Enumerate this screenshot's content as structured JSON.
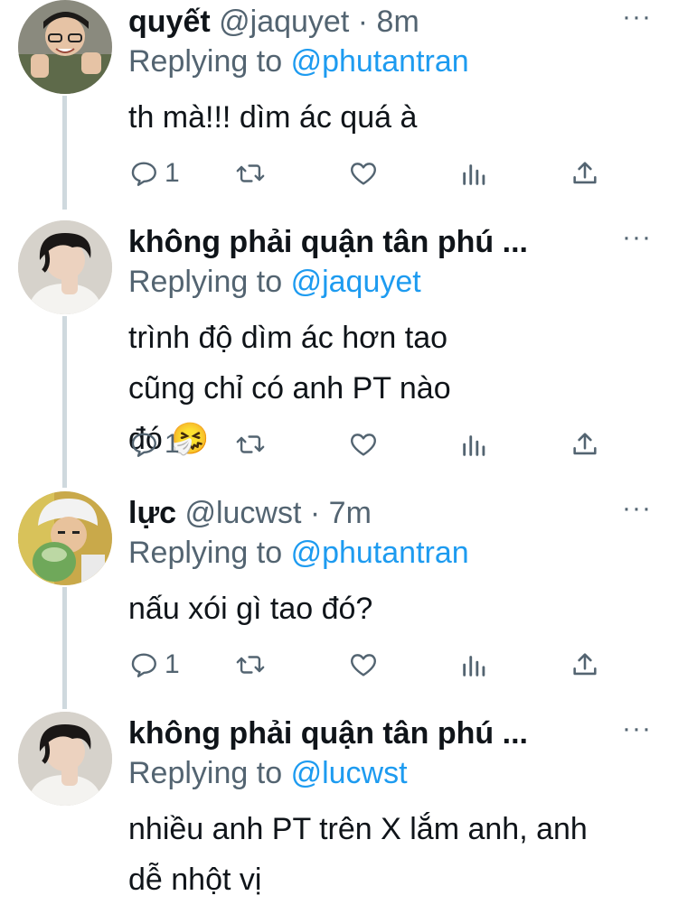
{
  "colors": {
    "accent": "#1d9bf0",
    "secondary": "#536471",
    "text": "#0f1419",
    "thread_line": "#cfd9de"
  },
  "replies": [
    {
      "name": "quyết",
      "handle": "@jaquyet",
      "dot": "·",
      "time": "8m",
      "more": "···",
      "replying_label": "Replying to",
      "replying_to": "@phutantran",
      "text": "th mà!!! dìm ác quá à",
      "reply_count": "1"
    },
    {
      "name": "không phải quận tân phú ...",
      "handle": "",
      "dot": "",
      "time": "",
      "more": "···",
      "replying_label": "Replying to",
      "replying_to": "@jaquyet",
      "text": "trình độ dìm ác hơn tao cũng chỉ có anh PT nào đó 🤧",
      "reply_count": "1"
    },
    {
      "name": "lực",
      "handle": "@lucwst",
      "dot": "·",
      "time": "7m",
      "more": "···",
      "replying_label": "Replying to",
      "replying_to": "@phutantran",
      "text": "nấu xói gì tao đó?",
      "reply_count": "1"
    },
    {
      "name": "không phải quận tân phú ...",
      "handle": "",
      "dot": "",
      "time": "",
      "more": "···",
      "replying_label": "Replying to",
      "replying_to": "@lucwst",
      "text": "nhiều anh PT trên X lắm anh, anh dễ nhột vị",
      "reply_count": ""
    }
  ]
}
